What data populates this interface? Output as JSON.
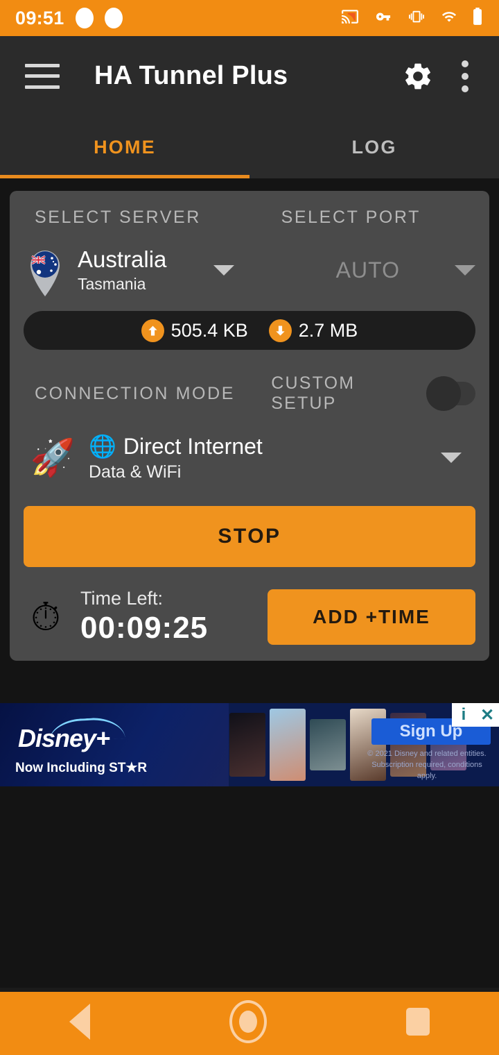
{
  "status_bar": {
    "time": "09:51",
    "notification_dots": 2,
    "icons": [
      "cast-icon",
      "vpn-key-icon",
      "vibrate-icon",
      "wifi-icon",
      "battery-icon"
    ],
    "background": "#F28C12"
  },
  "app_bar": {
    "menu_icon": "hamburger-menu-icon",
    "title": "HA Tunnel Plus",
    "settings_icon": "gear-icon",
    "overflow_icon": "kebab-menu-icon"
  },
  "tabs": {
    "items": [
      {
        "label": "HOME",
        "active": true
      },
      {
        "label": "LOG",
        "active": false
      }
    ],
    "active_color": "#F0931E",
    "inactive_color": "#bdbdbd"
  },
  "server_section": {
    "server_label": "SELECT SERVER",
    "port_label": "SELECT PORT",
    "server_country": "Australia",
    "server_region": "Tasmania",
    "server_icon": "map-pin-flag-icon",
    "port_value": "AUTO",
    "server_caret": "chevron-down-icon",
    "port_caret": "chevron-down-icon"
  },
  "traffic": {
    "upload_icon": "upload-arrow-icon",
    "upload_value": "505.4 KB",
    "download_icon": "download-arrow-icon",
    "download_value": "2.7 MB",
    "badge_color": "#F0931E"
  },
  "connection": {
    "mode_label": "CONNECTION MODE",
    "custom_setup_label": "CUSTOM SETUP",
    "custom_setup_enabled": false,
    "rocket_icon": "🚀",
    "globe_icon": "🌐",
    "mode_title": "Direct Internet",
    "mode_subtitle": "Data & WiFi",
    "mode_caret": "chevron-down-icon"
  },
  "actions": {
    "stop_label": "STOP",
    "add_time_label": "ADD +TIME",
    "button_color": "#F0931E"
  },
  "timer": {
    "clock_icon": "⏱",
    "label": "Time Left:",
    "value": "00:09:25"
  },
  "ad": {
    "brand": "Disney+",
    "tagline": "Now Including ST★R",
    "cta_label": "Sign Up",
    "fine_print": "© 2021 Disney and related entities. Subscription required, conditions apply.",
    "info_icon": "i",
    "close_icon": "✕"
  },
  "nav_bar": {
    "back_icon": "back-triangle-icon",
    "home_icon": "home-circle-icon",
    "recents_icon": "recents-square-icon",
    "background": "#F28C12"
  }
}
